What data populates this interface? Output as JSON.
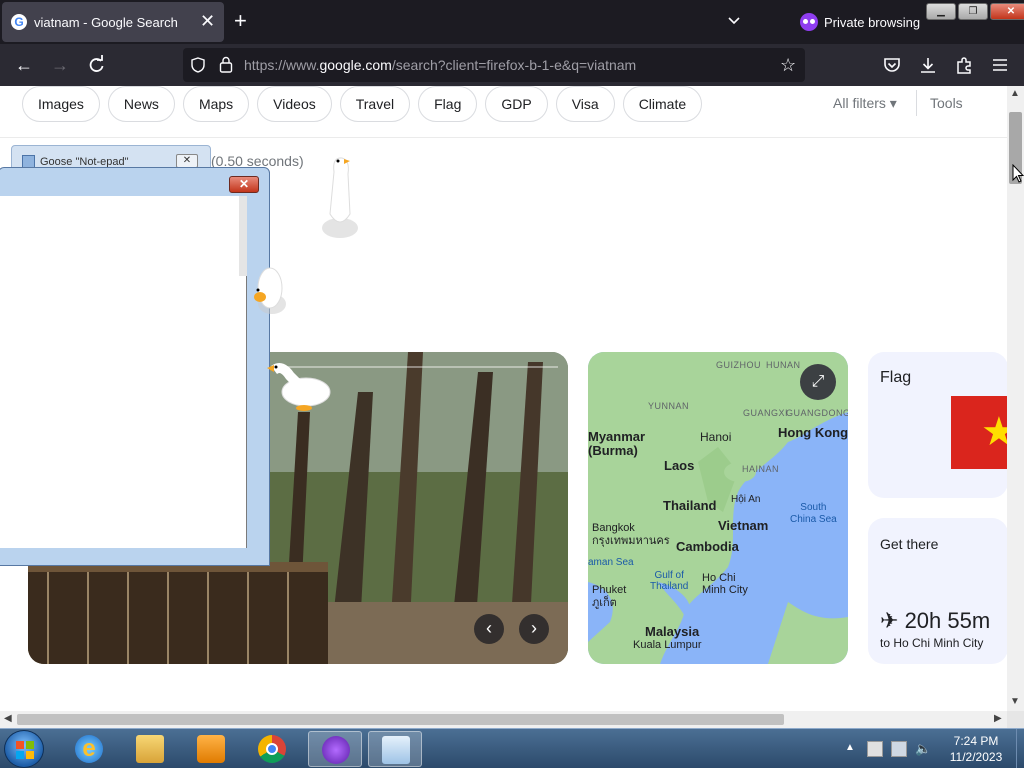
{
  "browser": {
    "tab_title": "viatnam - Google Search",
    "new_tab_symbol": "+",
    "private_label": "Private browsing",
    "url_prefix": "https://www.",
    "url_domain": "google.com",
    "url_rest": "/search?client=firefox-b-1-e&q=viatnam"
  },
  "filters": {
    "chips": [
      "Images",
      "News",
      "Maps",
      "Videos",
      "Travel",
      "Flag",
      "GDP",
      "Visa",
      "Climate"
    ],
    "all_filters": "All filters",
    "tools": "Tools"
  },
  "results": {
    "stats": "(0.50 seconds)"
  },
  "goose_tab": {
    "title": "Goose \"Not-epad\""
  },
  "map": {
    "labels": {
      "guizhou": "GUIZHOU",
      "hunan": "HUNAN",
      "yunnan": "YUNNAN",
      "guangxi": "GUANGXI",
      "guangdong": "GUANGDONG",
      "myanmar": "Myanmar\n(Burma)",
      "hanoi": "Hanoi",
      "hongkong": "Hong Kong",
      "laos": "Laos",
      "hainan": "HAINAN",
      "thailand": "Thailand",
      "hoian": "Hội An",
      "scs": "South\nChina Sea",
      "bangkok": "Bangkok\nกรุงเทพมหานคร",
      "vietnam": "Vietnam",
      "cambodia": "Cambodia",
      "andaman": "aman Sea",
      "gulf": "Gulf of\nThailand",
      "hcmc": "Ho Chi\nMinh City",
      "phuket": "Phuket\nภูเก็ต",
      "malaysia": "Malaysia",
      "kl": "Kuala Lumpur"
    }
  },
  "cards": {
    "flag_title": "Flag",
    "get_there_title": "Get there",
    "flight_time": "20h 55m",
    "destination": "to Ho Chi Minh City"
  },
  "taskbar": {
    "time": "7:24 PM",
    "date": "11/2/2023"
  },
  "colors": {
    "tabbar": "#1c1b22",
    "navbar": "#2b2a33",
    "private_purple": "#8f3ef0",
    "flag_red": "#da251d",
    "flag_star": "#ffde00"
  }
}
